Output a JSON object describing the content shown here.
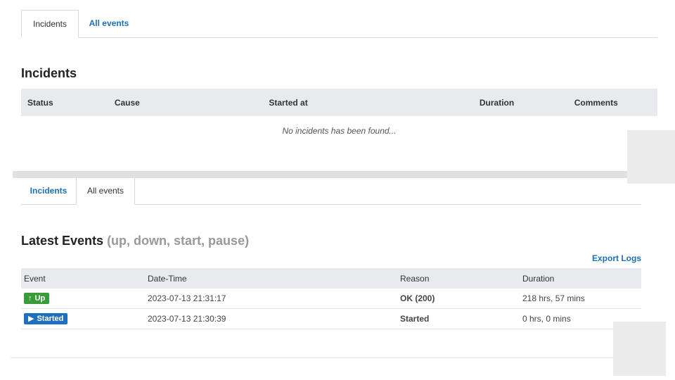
{
  "top_tabs": {
    "incidents": "Incidents",
    "all_events": "All events"
  },
  "incidents_section": {
    "heading": "Incidents",
    "columns": [
      "Status",
      "Cause",
      "Started at",
      "Duration",
      "Comments"
    ],
    "empty_message": "No incidents has been found..."
  },
  "bottom_tabs": {
    "incidents": "Incidents",
    "all_events": "All events"
  },
  "events_section": {
    "heading": "Latest Events",
    "subheading": "(up, down, start, pause)",
    "export_label": "Export Logs",
    "columns": [
      "Event",
      "Date-Time",
      "Reason",
      "Duration"
    ],
    "rows": [
      {
        "event": "Up",
        "event_icon": "arrow-up-icon",
        "datetime": "2023-07-13 21:31:17",
        "reason": "OK (200)",
        "duration": "218 hrs, 57 mins"
      },
      {
        "event": "Started",
        "event_icon": "play-icon",
        "datetime": "2023-07-13 21:30:39",
        "reason": "Started",
        "duration": "0 hrs, 0 mins"
      }
    ]
  },
  "colors": {
    "link": "#1d6fb8",
    "up_badge": "#3a9b3a",
    "started_badge": "#1f6fc0",
    "header_bg": "#e8eaed"
  }
}
